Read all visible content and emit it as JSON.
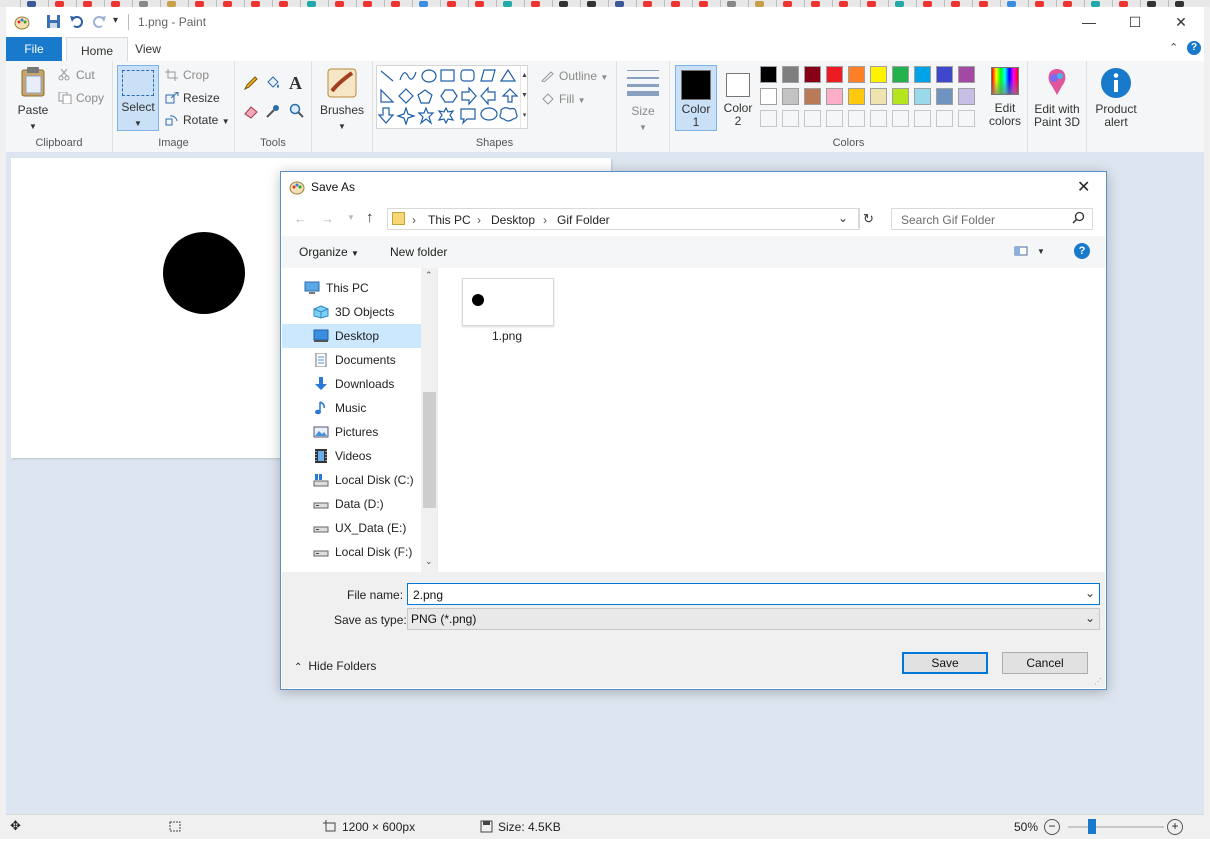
{
  "window": {
    "title": "1.png - Paint"
  },
  "ribbon": {
    "tabs": [
      "File",
      "Home",
      "View"
    ],
    "clipboard": {
      "paste": "Paste",
      "cut": "Cut",
      "copy": "Copy",
      "group": "Clipboard"
    },
    "image": {
      "select": "Select",
      "crop": "Crop",
      "resize": "Resize",
      "rotate": "Rotate",
      "group": "Image"
    },
    "tools": {
      "group": "Tools"
    },
    "brushes": {
      "label": "Brushes"
    },
    "shapes": {
      "outline": "Outline",
      "fill": "Fill",
      "group": "Shapes"
    },
    "size": {
      "label": "Size"
    },
    "colors": {
      "color1_line1": "Color",
      "color1_line2": "1",
      "color2_line1": "Color",
      "color2_line2": "2",
      "edit_line1": "Edit",
      "edit_line2": "colors",
      "group": "Colors",
      "color1": "#000000",
      "color2": "#ffffff",
      "palette_row1": [
        "#000000",
        "#7f7f7f",
        "#880015",
        "#ed1c24",
        "#ff7f27",
        "#fff200",
        "#22b14c",
        "#00a2e8",
        "#3f48cc",
        "#a349a4"
      ],
      "palette_row2": [
        "#ffffff",
        "#c3c3c3",
        "#b97a57",
        "#ffaec9",
        "#ffc90e",
        "#efe4b0",
        "#b5e61d",
        "#99d9ea",
        "#7092be",
        "#c8bfe7"
      ]
    },
    "paint3d": {
      "line1": "Edit with",
      "line2": "Paint 3D"
    },
    "product_alert": {
      "line1": "Product",
      "line2": "alert"
    }
  },
  "status": {
    "dimensions": "1200 × 600px",
    "size": "Size: 4.5KB",
    "zoom": "50%",
    "zoom_level": 0.5
  },
  "dialog": {
    "title": "Save As",
    "breadcrumb": [
      "This PC",
      "Desktop",
      "Gif Folder"
    ],
    "search_placeholder": "Search Gif Folder",
    "organize": "Organize",
    "new_folder": "New folder",
    "nav_items": [
      "This PC",
      "3D Objects",
      "Desktop",
      "Documents",
      "Downloads",
      "Music",
      "Pictures",
      "Videos",
      "Local Disk (C:)",
      "Data (D:)",
      "UX_Data (E:)",
      "Local Disk (F:)"
    ],
    "selected_nav": "Desktop",
    "files": [
      {
        "name": "1.png"
      }
    ],
    "file_name_label": "File name:",
    "file_name_value": "2.png",
    "save_type_label": "Save as type:",
    "save_type_value": "PNG (*.png)",
    "hide_folders": "Hide Folders",
    "save_button": "Save",
    "cancel_button": "Cancel"
  }
}
